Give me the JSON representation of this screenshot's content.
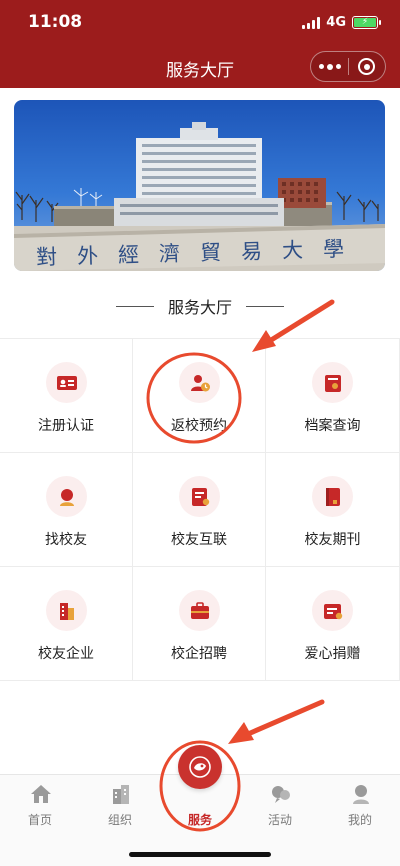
{
  "status_bar": {
    "time": "11:08",
    "network": "4G",
    "battery_charging": true
  },
  "nav": {
    "title": "服务大厅",
    "more_icon": "more-dots-icon",
    "close_icon": "close-circle-icon"
  },
  "banner": {
    "image": "campus-main-building",
    "inscription": "對外經濟貿易大學"
  },
  "section": {
    "title": "服务大厅"
  },
  "services": [
    {
      "label": "注册认证",
      "icon": "id-card-icon"
    },
    {
      "label": "返校预约",
      "icon": "user-clock-icon"
    },
    {
      "label": "档案查询",
      "icon": "archive-icon"
    },
    {
      "label": "找校友",
      "icon": "search-person-icon"
    },
    {
      "label": "校友互联",
      "icon": "document-icon"
    },
    {
      "label": "校友期刊",
      "icon": "book-icon"
    },
    {
      "label": "校友企业",
      "icon": "building-icon"
    },
    {
      "label": "校企招聘",
      "icon": "briefcase-icon"
    },
    {
      "label": "爱心捐赠",
      "icon": "donation-card-icon"
    }
  ],
  "tabbar": {
    "items": [
      {
        "label": "首页",
        "icon": "home-icon"
      },
      {
        "label": "组织",
        "icon": "organization-icon"
      },
      {
        "label": "服务",
        "icon": "service-icon",
        "active": true
      },
      {
        "label": "活动",
        "icon": "activity-icon"
      },
      {
        "label": "我的",
        "icon": "profile-icon"
      }
    ]
  },
  "colors": {
    "brand": "#9c1c1c",
    "icon_bg": "#fbeeee",
    "icon_fg": "#c62828",
    "annotation": "#e84a2e"
  }
}
